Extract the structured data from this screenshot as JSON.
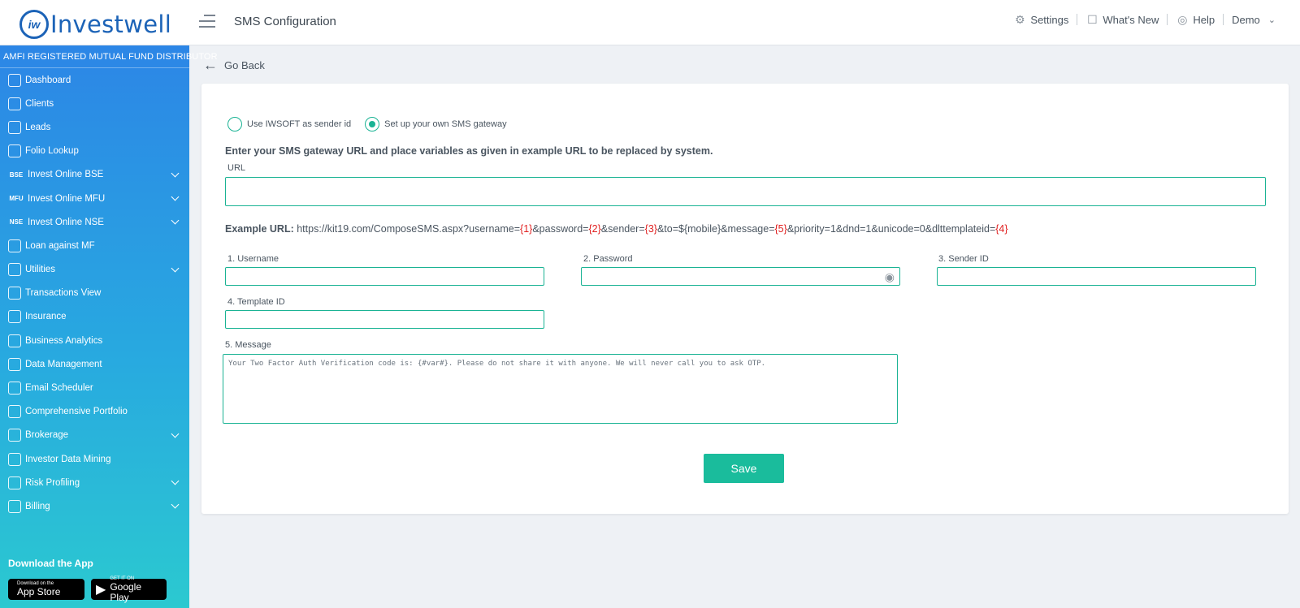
{
  "header": {
    "logo_mark": "iw",
    "logo_text": "Investwell",
    "page_title": "SMS Configuration",
    "settings": "Settings",
    "whats_new": "What's New",
    "help": "Help",
    "user": "Demo"
  },
  "sidebar": {
    "amfi": "AMFI REGISTERED MUTUAL FUND DISTRIBUTOR",
    "items": [
      {
        "label": "Dashboard",
        "icon": "home-icon"
      },
      {
        "label": "Clients",
        "icon": "clients-icon"
      },
      {
        "label": "Leads",
        "icon": "leads-icon"
      },
      {
        "label": "Folio Lookup",
        "icon": "folio-icon"
      },
      {
        "label": "Invest Online BSE",
        "icon_text": "BSE",
        "expandable": true
      },
      {
        "label": "Invest Online MFU",
        "icon_text": "MFU",
        "expandable": true
      },
      {
        "label": "Invest Online NSE",
        "icon_text": "NSE",
        "expandable": true
      },
      {
        "label": "Loan against MF",
        "icon": "loan-icon"
      },
      {
        "label": "Utilities",
        "icon": "utilities-icon",
        "expandable": true
      },
      {
        "label": "Transactions View",
        "icon": "transactions-icon"
      },
      {
        "label": "Insurance",
        "icon": "insurance-icon"
      },
      {
        "label": "Business Analytics",
        "icon": "analytics-icon"
      },
      {
        "label": "Data Management",
        "icon": "data-icon"
      },
      {
        "label": "Email Scheduler",
        "icon": "email-icon"
      },
      {
        "label": "Comprehensive Portfolio",
        "icon": "portfolio-icon"
      },
      {
        "label": "Brokerage",
        "icon": "brokerage-icon",
        "expandable": true
      },
      {
        "label": "Investor Data Mining",
        "icon": "mining-icon"
      },
      {
        "label": "Risk Profiling",
        "icon": "risk-icon",
        "expandable": true
      },
      {
        "label": "Billing",
        "icon": "billing-icon",
        "expandable": true
      }
    ],
    "download_title": "Download the App",
    "app_store_small": "Download on the",
    "app_store_big": "App Store",
    "google_play_small": "GET IT ON",
    "google_play_big": "Google Play"
  },
  "main": {
    "go_back": "Go Back",
    "radio_option_1": "Use IWSOFT as sender id",
    "radio_option_2": "Set up your own SMS gateway",
    "selected_option": "Set up your own SMS gateway",
    "instruction": "Enter your SMS gateway URL and place variables as given in example URL to be replaced by system.",
    "url_label": "URL",
    "url_value": "",
    "example_label": "Example URL:",
    "example_parts": [
      "https://kit19.com/ComposeSMS.aspx?username=",
      "{1}",
      "&password=",
      "{2}",
      "&sender=",
      "{3}",
      "&to=${mobile}&message=",
      "{5}",
      "&priority=1&dnd=1&unicode=0&dlttemplateid=",
      "{4}"
    ],
    "username_label": "1. Username",
    "password_label": "2. Password",
    "sender_label": "3. Sender ID",
    "template_label": "4. Template ID",
    "message_label": "5. Message",
    "message_value": "Your Two Factor Auth Verification code is: {#var#}. Please do not share it with anyone. We will never call you to ask OTP.",
    "save_label": "Save"
  },
  "colors": {
    "accent": "#1abc9c",
    "brand": "#1c63b7",
    "variable": "#e02020"
  }
}
